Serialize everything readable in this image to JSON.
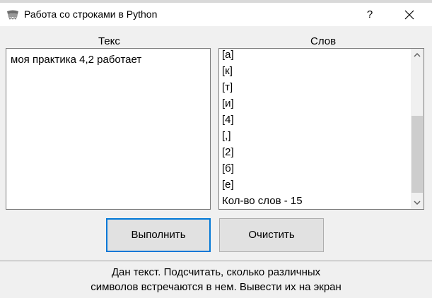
{
  "window": {
    "title": "Работа со строками в Python",
    "help_label": "?"
  },
  "text_panel": {
    "label": "Текс",
    "content": "моя практика 4,2 работает"
  },
  "words_panel": {
    "label": "Слов",
    "items": [
      "[а]",
      "[к]",
      "[т]",
      "[и]",
      "[4]",
      "[,]",
      "[2]",
      "[б]",
      "[е]",
      "Кол-во слов - 15"
    ],
    "scrollbar_position": 0.72
  },
  "buttons": {
    "run_label": "Выполнить",
    "clear_label": "Очистить"
  },
  "description": {
    "line1": "Дан текст. Подсчитать, сколько различных",
    "line2": "символов встречаются в нем. Вывести их на экран"
  },
  "colors": {
    "accent": "#0078d7",
    "client_bg": "#f0f0f0",
    "button_bg": "#e1e1e1"
  }
}
